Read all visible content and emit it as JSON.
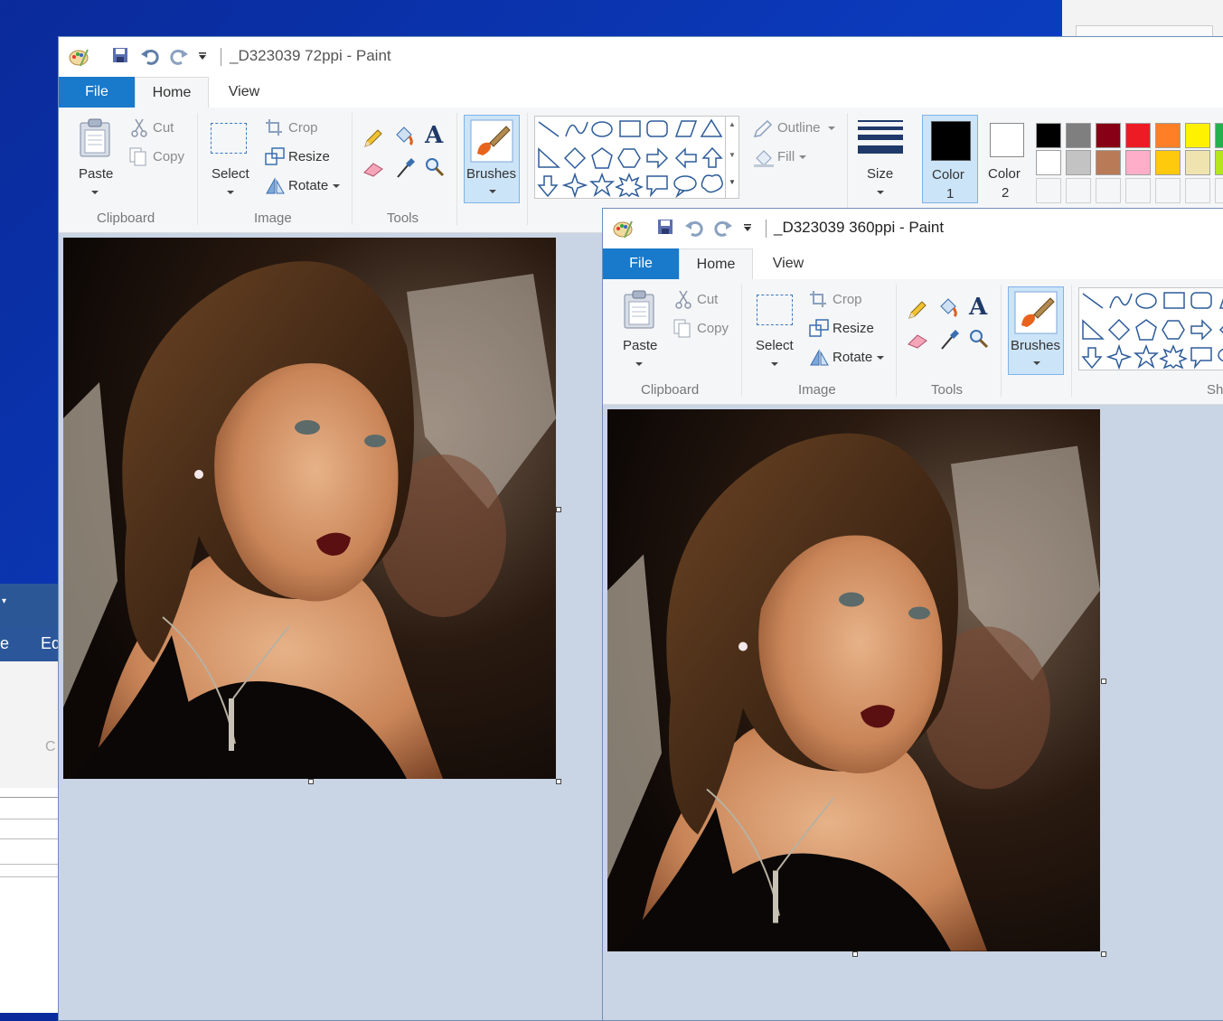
{
  "window_back": {
    "title": "_D323039 72ppi - Paint",
    "tabs": {
      "file": "File",
      "home": "Home",
      "view": "View"
    },
    "clipboard": {
      "paste": "Paste",
      "cut": "Cut",
      "copy": "Copy",
      "label": "Clipboard"
    },
    "image": {
      "select": "Select",
      "crop": "Crop",
      "resize": "Resize",
      "rotate": "Rotate",
      "label": "Image"
    },
    "tools": {
      "label": "Tools"
    },
    "brushes": "Brushes",
    "outline": "Outline",
    "fill": "Fill",
    "size": "Size",
    "color1": {
      "label": "Color",
      "num": "1"
    },
    "color2": {
      "label": "Color",
      "num": "2"
    },
    "palette_row1": [
      "#000000",
      "#7f7f7f",
      "#880015",
      "#ed1c24",
      "#ff7f27",
      "#fff200",
      "#22b14c"
    ],
    "palette_row2": [
      "#ffffff",
      "#c3c3c3",
      "#b97a57",
      "#ffaec9",
      "#ffc90e",
      "#efe4b0",
      "#b5e61d"
    ]
  },
  "window_front": {
    "title": "_D323039 360ppi - Paint",
    "tabs": {
      "file": "File",
      "home": "Home",
      "view": "View"
    },
    "clipboard": {
      "paste": "Paste",
      "cut": "Cut",
      "copy": "Copy",
      "label": "Clipboard"
    },
    "image": {
      "select": "Select",
      "crop": "Crop",
      "resize": "Resize",
      "rotate": "Rotate",
      "label": "Image"
    },
    "tools": {
      "label": "Tools"
    },
    "brushes": "Brushes",
    "shapes_label_partial": "Sh"
  },
  "background_window": {
    "tab_partial_1": "e",
    "tab_partial_2": "Ed",
    "label_partial": "C"
  },
  "colors": {
    "accent": "#1979ca",
    "canvas_bg": "#c9d4e4",
    "ribbon_bg": "#f5f6f7",
    "selected_bg": "#cce4f7"
  }
}
